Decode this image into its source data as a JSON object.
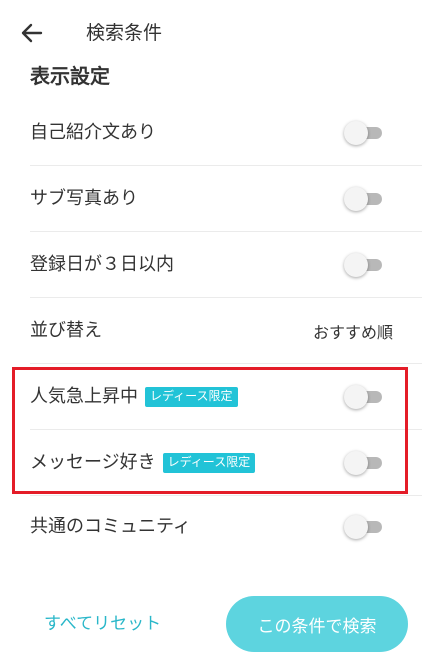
{
  "header": {
    "title": "検索条件"
  },
  "section": {
    "title": "表示設定"
  },
  "rows": [
    {
      "label": "自己紹介文あり",
      "toggle_on": false
    },
    {
      "label": "サブ写真あり",
      "toggle_on": false
    },
    {
      "label": "登録日が３日以内",
      "toggle_on": false
    },
    {
      "label": "並び替え",
      "value": "おすすめ順"
    },
    {
      "label": "人気急上昇中",
      "badge": "レディース限定",
      "toggle_on": false
    },
    {
      "label": "メッセージ好き",
      "badge": "レディース限定",
      "toggle_on": false
    },
    {
      "label": "共通のコミュニティ",
      "toggle_on": false
    }
  ],
  "footer": {
    "reset_label": "すべてリセット",
    "search_label": "この条件で検索"
  },
  "colors": {
    "accent": "#29b7c9",
    "badge": "#22c3d7",
    "button": "#5dd4df",
    "highlight": "#e41c28"
  }
}
